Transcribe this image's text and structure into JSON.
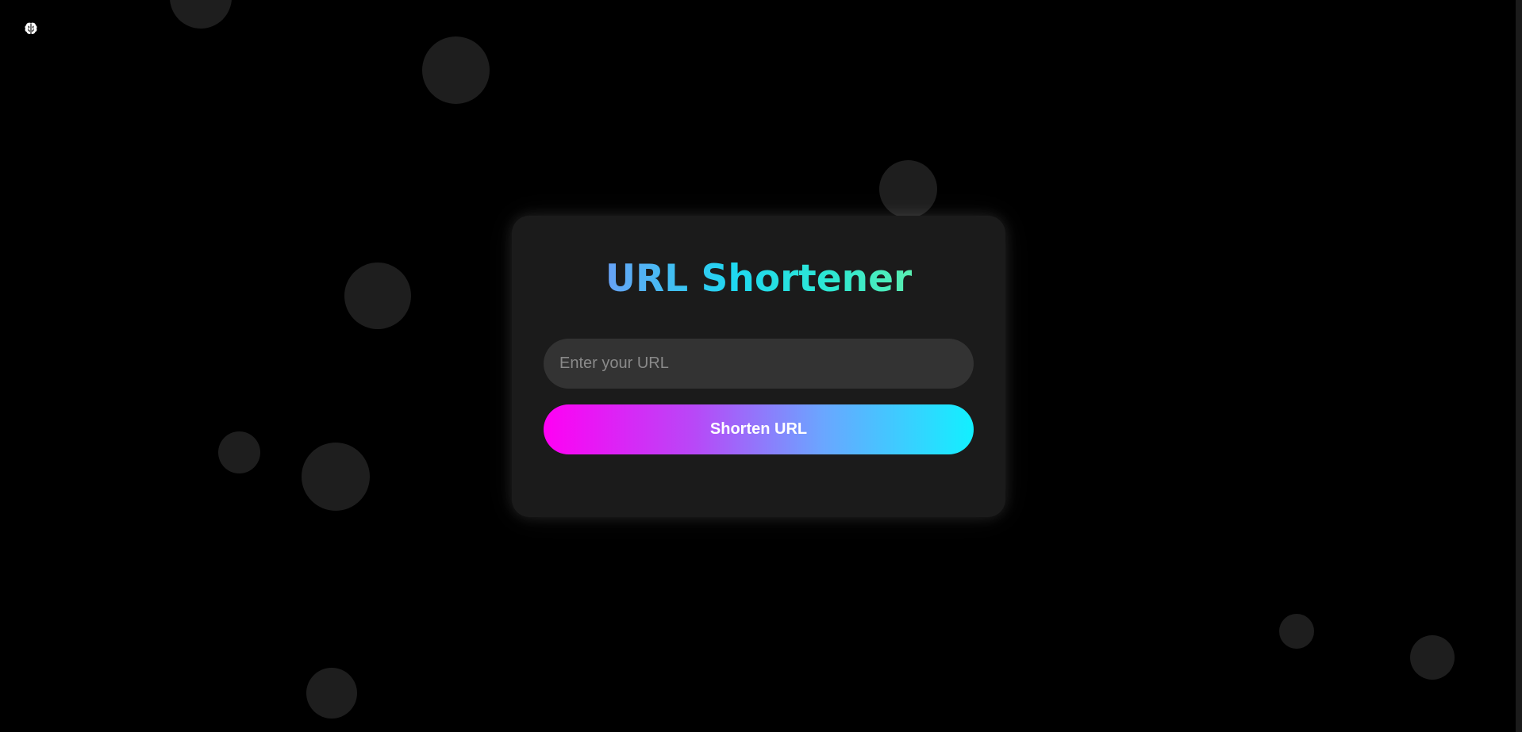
{
  "app": {
    "icon": "brain-icon"
  },
  "card": {
    "title": "URL Shortener",
    "input_placeholder": "Enter your URL",
    "input_value": "",
    "button_label": "Shorten URL"
  },
  "colors": {
    "background": "#000000",
    "card": "#1b1b1b",
    "input": "#333333",
    "bubble": "#1e1e1e",
    "title_gradient": [
      "#a66bff",
      "#1fd8f0",
      "#8cf58a"
    ],
    "button_gradient": [
      "#ff00f4",
      "#6aa6ff",
      "#12f0ff"
    ]
  }
}
